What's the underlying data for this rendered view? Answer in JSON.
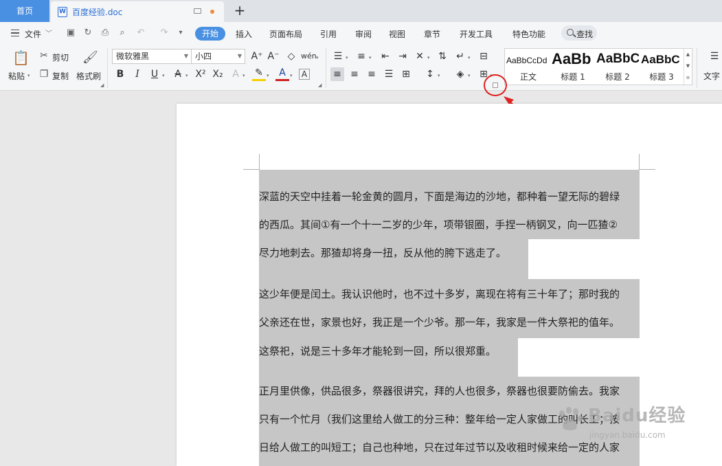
{
  "tabs": {
    "home": "首页",
    "document": "百度经验.doc",
    "add": "+"
  },
  "menu": {
    "file": "文件",
    "items": [
      "开始",
      "插入",
      "页面布局",
      "引用",
      "审阅",
      "视图",
      "章节",
      "开发工具",
      "特色功能"
    ],
    "search": "查找"
  },
  "ribbon": {
    "paste": "粘贴",
    "cut": "剪切",
    "copy": "复制",
    "format_painter": "格式刷",
    "font_name": "微软雅黑",
    "font_size": "小四",
    "styles": [
      {
        "sample": "AaBbCcDd",
        "name": "正文"
      },
      {
        "sample": "AaBb",
        "name": "标题 1"
      },
      {
        "sample": "AaBbC",
        "name": "标题 2"
      },
      {
        "sample": "AaBbC",
        "name": "标题 3"
      }
    ],
    "text_tool": "文字"
  },
  "document": {
    "paragraphs": [
      [
        "深蓝的天空中挂着一轮金黄的圆月，下面是海边的沙地，都种着一望无际的碧绿",
        "的西瓜。其间①有一个十一二岁的少年，项带银圈，手捏一柄钢叉，向一匹猹②",
        "尽力地刺去。那猹却将身一扭，反从他的胯下逃走了。"
      ],
      [
        "这少年便是闰土。我认识他时，也不过十多岁，离现在将有三十年了；那时我的",
        "父亲还在世，家景也好，我正是一个少爷。那一年，我家是一件大祭祀的值年。",
        "这祭祀，说是三十多年才能轮到一回，所以很郑重。"
      ],
      [
        "正月里供像，供品很多，祭器很讲究，拜的人也很多，祭器也很要防偷去。我家",
        "只有一个忙月（我们这里给人做工的分三种：整年给一定人家做工的叫长工；按",
        "日给人做工的叫短工；自己也种地，只在过年过节以及收租时候来给一定的人家"
      ]
    ]
  },
  "watermark": {
    "main": "Baidu经验",
    "sub": "jingyan.baidu.com"
  },
  "colors": {
    "accent": "#4a90e2",
    "selection": "#c6c6c6",
    "annotation": "#e02020"
  }
}
